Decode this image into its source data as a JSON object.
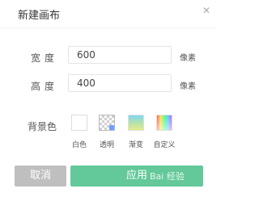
{
  "dialog": {
    "title": "新建画布",
    "close_icon": "close-icon"
  },
  "width": {
    "label": "宽度",
    "value": "600",
    "unit": "像素"
  },
  "height": {
    "label": "高度",
    "value": "400",
    "unit": "像素"
  },
  "background": {
    "label": "背景色",
    "options": [
      {
        "label": "白色",
        "icon": "white-swatch"
      },
      {
        "label": "透明",
        "icon": "transparent-swatch"
      },
      {
        "label": "渐变",
        "icon": "gradient-swatch"
      },
      {
        "label": "自定义",
        "icon": "custom-color-swatch"
      }
    ],
    "selected": "透明"
  },
  "buttons": {
    "cancel": "取消",
    "confirm": "应用"
  },
  "watermark": "Bai 经验"
}
